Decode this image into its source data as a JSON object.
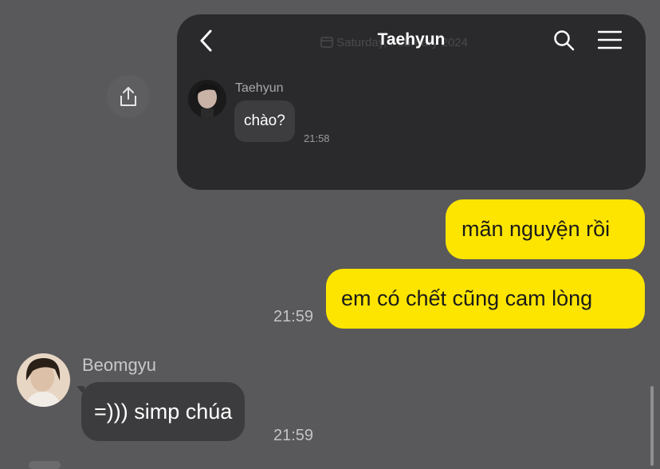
{
  "shared_card": {
    "title": "Taehyun",
    "date_hint": "Saturday, February 2024",
    "message": {
      "sender": "Taehyun",
      "text": "chào?",
      "time": "21:58"
    },
    "icons": {
      "back": "chevron-left-icon",
      "search": "search-icon",
      "menu": "hamburger-menu-icon"
    }
  },
  "share_button": {
    "icon": "share-upload-icon"
  },
  "outgoing": {
    "messages": [
      {
        "text": "mãn nguyện rồi"
      },
      {
        "text": "em có chết cũng cam lòng"
      }
    ],
    "time": "21:59",
    "bubble_color": "#fee500"
  },
  "incoming": {
    "sender": "Beomgyu",
    "text": "=))) simp chúa",
    "time": "21:59"
  }
}
